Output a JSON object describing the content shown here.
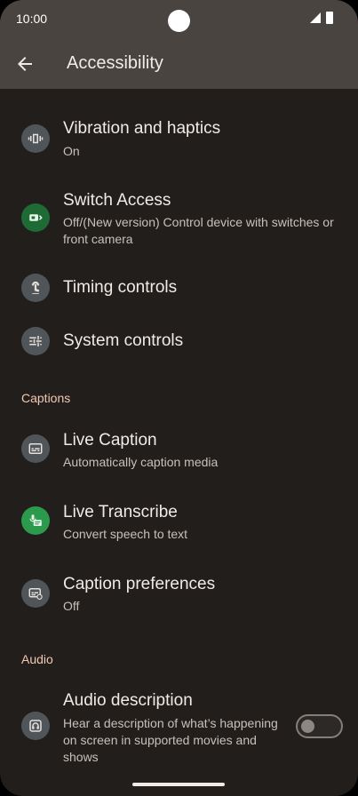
{
  "status_bar": {
    "time": "10:00"
  },
  "app_bar": {
    "title": "Accessibility"
  },
  "items_top": [
    {
      "title": "Vibration and haptics",
      "subtitle": "On",
      "icon": "vibration-icon"
    },
    {
      "title": "Switch Access",
      "subtitle": "Off/(New version) Control device with switches or front camera",
      "icon": "switch-access-icon"
    },
    {
      "title": "Timing controls",
      "icon": "timing-icon"
    },
    {
      "title": "System controls",
      "icon": "tune-icon"
    }
  ],
  "captions_section": {
    "header": "Captions",
    "items": [
      {
        "title": "Live Caption",
        "subtitle": "Automatically caption media",
        "icon": "caption-icon"
      },
      {
        "title": "Live Transcribe",
        "subtitle": "Convert speech to text",
        "icon": "transcribe-icon"
      },
      {
        "title": "Caption preferences",
        "subtitle": "Off",
        "icon": "caption-settings-icon"
      }
    ]
  },
  "audio_section": {
    "header": "Audio",
    "items": [
      {
        "title": "Audio description",
        "subtitle": "Hear a description of what’s happening on screen in supported movies and shows",
        "icon": "audio-description-icon",
        "toggle_on": false
      }
    ]
  },
  "colors": {
    "background": "#221e1c",
    "app_bar": "#4a4441",
    "accent_section": "#f3c9b4"
  }
}
